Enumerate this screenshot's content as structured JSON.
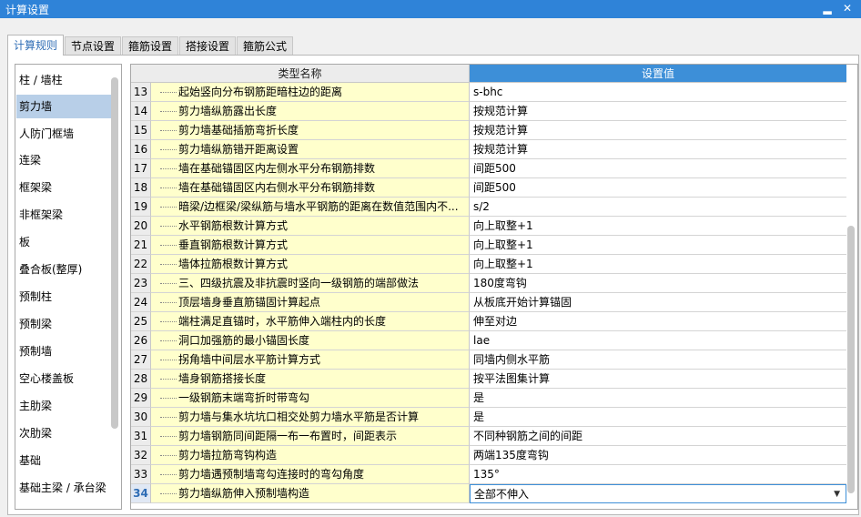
{
  "window": {
    "title": "计算设置",
    "minimize": "▂",
    "close": "✕"
  },
  "tabs": [
    {
      "label": "计算规则",
      "active": true
    },
    {
      "label": "节点设置",
      "active": false
    },
    {
      "label": "箍筋设置",
      "active": false
    },
    {
      "label": "搭接设置",
      "active": false
    },
    {
      "label": "箍筋公式",
      "active": false
    }
  ],
  "sidebar": {
    "items": [
      {
        "label": "柱 / 墙柱"
      },
      {
        "label": "剪力墙",
        "selected": true
      },
      {
        "label": "人防门框墙"
      },
      {
        "label": "连梁"
      },
      {
        "label": "框架梁"
      },
      {
        "label": "非框架梁"
      },
      {
        "label": "板"
      },
      {
        "label": "叠合板(整厚)"
      },
      {
        "label": "预制柱"
      },
      {
        "label": "预制梁"
      },
      {
        "label": "预制墙"
      },
      {
        "label": "空心楼盖板"
      },
      {
        "label": "主肋梁"
      },
      {
        "label": "次肋梁"
      },
      {
        "label": "基础"
      },
      {
        "label": "基础主梁 / 承台梁"
      }
    ]
  },
  "table": {
    "headers": {
      "name": "类型名称",
      "value": "设置值"
    },
    "rows": [
      {
        "num": "13",
        "name": "起始竖向分布钢筋距暗柱边的距离",
        "value": "s-bhc"
      },
      {
        "num": "14",
        "name": "剪力墙纵筋露出长度",
        "value": "按规范计算"
      },
      {
        "num": "15",
        "name": "剪力墙基础插筋弯折长度",
        "value": "按规范计算"
      },
      {
        "num": "16",
        "name": "剪力墙纵筋错开距离设置",
        "value": "按规范计算"
      },
      {
        "num": "17",
        "name": "墙在基础锚固区内左侧水平分布钢筋排数",
        "value": "间距500"
      },
      {
        "num": "18",
        "name": "墙在基础锚固区内右侧水平分布钢筋排数",
        "value": "间距500"
      },
      {
        "num": "19",
        "name": "暗梁/边框梁/梁纵筋与墙水平钢筋的距离在数值范围内不...",
        "value": "s/2"
      },
      {
        "num": "20",
        "name": "水平钢筋根数计算方式",
        "value": "向上取整+1"
      },
      {
        "num": "21",
        "name": "垂直钢筋根数计算方式",
        "value": "向上取整+1"
      },
      {
        "num": "22",
        "name": "墙体拉筋根数计算方式",
        "value": "向上取整+1"
      },
      {
        "num": "23",
        "name": "三、四级抗震及非抗震时竖向一级钢筋的端部做法",
        "value": "180度弯钩"
      },
      {
        "num": "24",
        "name": "顶层墙身垂直筋锚固计算起点",
        "value": "从板底开始计算锚固"
      },
      {
        "num": "25",
        "name": "端柱满足直锚时，水平筋伸入端柱内的长度",
        "value": "伸至对边"
      },
      {
        "num": "26",
        "name": "洞口加强筋的最小锚固长度",
        "value": "lae"
      },
      {
        "num": "27",
        "name": "拐角墙中间层水平筋计算方式",
        "value": "同墙内侧水平筋"
      },
      {
        "num": "28",
        "name": "墙身钢筋搭接长度",
        "value": "按平法图集计算"
      },
      {
        "num": "29",
        "name": "一级钢筋末端弯折时带弯勾",
        "value": "是"
      },
      {
        "num": "30",
        "name": "剪力墙与集水坑坑口相交处剪力墙水平筋是否计算",
        "value": "是"
      },
      {
        "num": "31",
        "name": "剪力墙钢筋同间距隔一布一布置时，间距表示",
        "value": "不同种钢筋之间的间距"
      },
      {
        "num": "32",
        "name": "剪力墙拉筋弯钩构造",
        "value": "两端135度弯钩"
      },
      {
        "num": "33",
        "name": "剪力墙遇预制墙弯勾连接时的弯勾角度",
        "value": "135°"
      },
      {
        "num": "34",
        "name": "剪力墙纵筋伸入预制墙构造",
        "value": "全部不伸入",
        "selected": true
      }
    ]
  }
}
